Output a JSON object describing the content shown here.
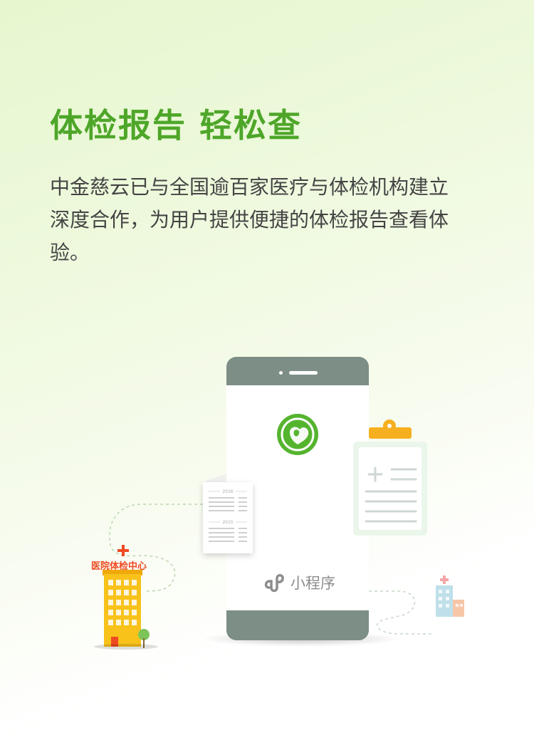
{
  "title": "体检报告 轻松查",
  "description": "中金慈云已与全国逾百家医疗与体检机构建立深度合作，为用户提供便捷的体检报告查看体验。",
  "illustration": {
    "mini_program_label": "小程序",
    "hospital_label": "医院体检中心",
    "report_years": [
      "2016",
      "2015"
    ],
    "colors": {
      "title": "#4ea629",
      "phone": "#7d8e86",
      "logo": "#55b42e",
      "building": "#f8c21b",
      "hospital_label": "#ef4b22",
      "clipboard": "#f6b01f"
    },
    "icons": [
      "app-logo-icon",
      "mini-program-icon",
      "hospital-cross-icon",
      "tree-icon",
      "clipboard-icon",
      "report-document-icon",
      "small-hospital-icon"
    ]
  }
}
